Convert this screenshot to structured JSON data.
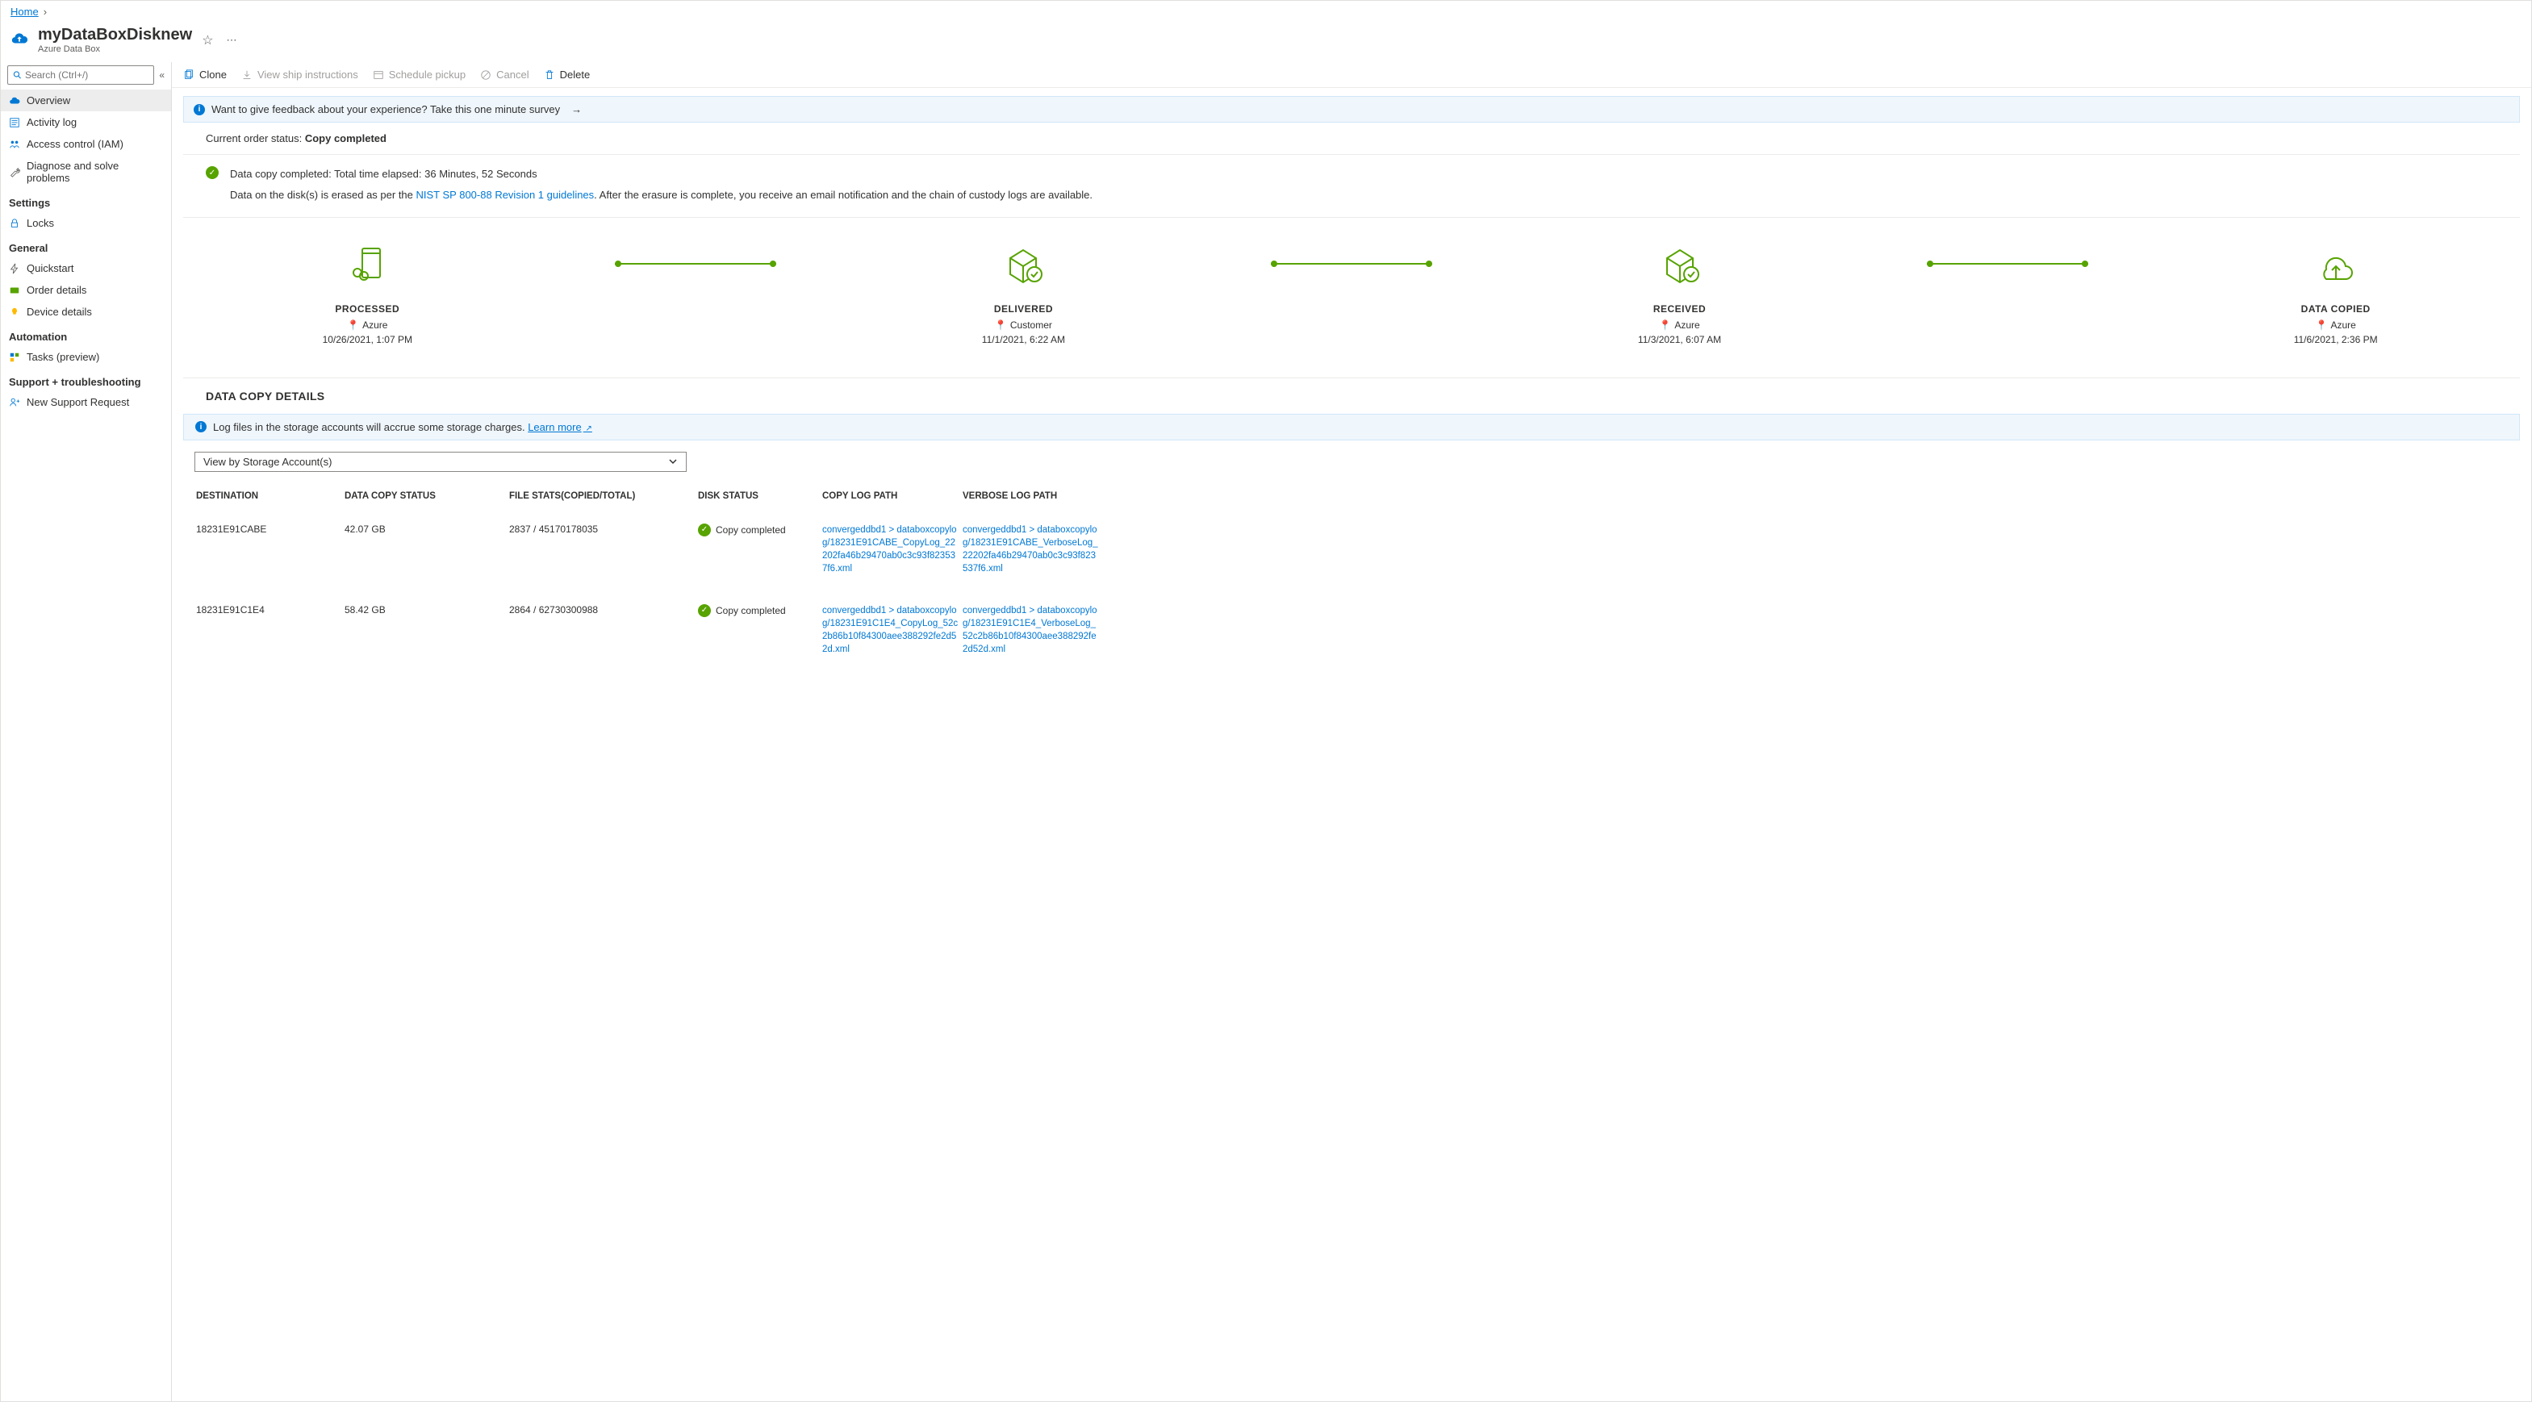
{
  "breadcrumb": {
    "home": "Home"
  },
  "header": {
    "title": "myDataBoxDisknew",
    "subtitle": "Azure Data Box"
  },
  "search": {
    "placeholder": "Search (Ctrl+/)"
  },
  "nav": {
    "top": [
      {
        "label": "Overview"
      },
      {
        "label": "Activity log"
      },
      {
        "label": "Access control (IAM)"
      },
      {
        "label": "Diagnose and solve problems"
      }
    ],
    "groups": [
      {
        "title": "Settings",
        "items": [
          {
            "label": "Locks"
          }
        ]
      },
      {
        "title": "General",
        "items": [
          {
            "label": "Quickstart"
          },
          {
            "label": "Order details"
          },
          {
            "label": "Device details"
          }
        ]
      },
      {
        "title": "Automation",
        "items": [
          {
            "label": "Tasks (preview)"
          }
        ]
      },
      {
        "title": "Support + troubleshooting",
        "items": [
          {
            "label": "New Support Request"
          }
        ]
      }
    ]
  },
  "toolbar": {
    "clone": "Clone",
    "ship": "View ship instructions",
    "pickup": "Schedule pickup",
    "cancel": "Cancel",
    "delete": "Delete"
  },
  "feedback": "Want to give feedback about your experience? Take this one minute survey",
  "status": {
    "label": "Current order status: ",
    "value": "Copy completed"
  },
  "copy": {
    "msg": "Data copy completed: Total time elapsed: 36 Minutes, 52 Seconds",
    "erase1": "Data on the disk(s) is erased as per the ",
    "erase_link": "NIST SP 800-88 Revision 1 guidelines",
    "erase2": ". After the erasure is complete, you receive an email notification and the chain of custody logs are available."
  },
  "stages": [
    {
      "title": "PROCESSED",
      "loc": "Azure",
      "time": "10/26/2021, 1:07 PM"
    },
    {
      "title": "DELIVERED",
      "loc": "Customer",
      "time": "11/1/2021, 6:22 AM"
    },
    {
      "title": "RECEIVED",
      "loc": "Azure",
      "time": "11/3/2021, 6:07 AM"
    },
    {
      "title": "DATA COPIED",
      "loc": "Azure",
      "time": "11/6/2021, 2:36 PM"
    }
  ],
  "details": {
    "heading": "DATA COPY DETAILS",
    "banner": "Log files in the storage accounts will accrue some storage charges.  ",
    "learn": "Learn more",
    "view": "View by Storage Account(s)",
    "columns": [
      "DESTINATION",
      "DATA COPY STATUS",
      "FILE STATS(COPIED/TOTAL)",
      "DISK STATUS",
      "COPY LOG PATH",
      "VERBOSE LOG PATH"
    ],
    "rows": [
      {
        "dest": "18231E91CABE",
        "size": "42.07 GB",
        "stats": "2837 / 45170178035",
        "status": "Copy completed",
        "copylog": "convergeddbd1 > databoxcopylog/18231E91CABE_CopyLog_22202fa46b29470ab0c3c93f823537f6.xml",
        "verbose": "convergeddbd1 > databoxcopylog/18231E91CABE_VerboseLog_22202fa46b29470ab0c3c93f823537f6.xml"
      },
      {
        "dest": "18231E91C1E4",
        "size": "58.42 GB",
        "stats": "2864 / 62730300988",
        "status": "Copy completed",
        "copylog": "convergeddbd1 > databoxcopylog/18231E91C1E4_CopyLog_52c2b86b10f84300aee388292fe2d52d.xml",
        "verbose": "convergeddbd1 > databoxcopylog/18231E91C1E4_VerboseLog_52c2b86b10f84300aee388292fe2d52d.xml"
      }
    ]
  }
}
